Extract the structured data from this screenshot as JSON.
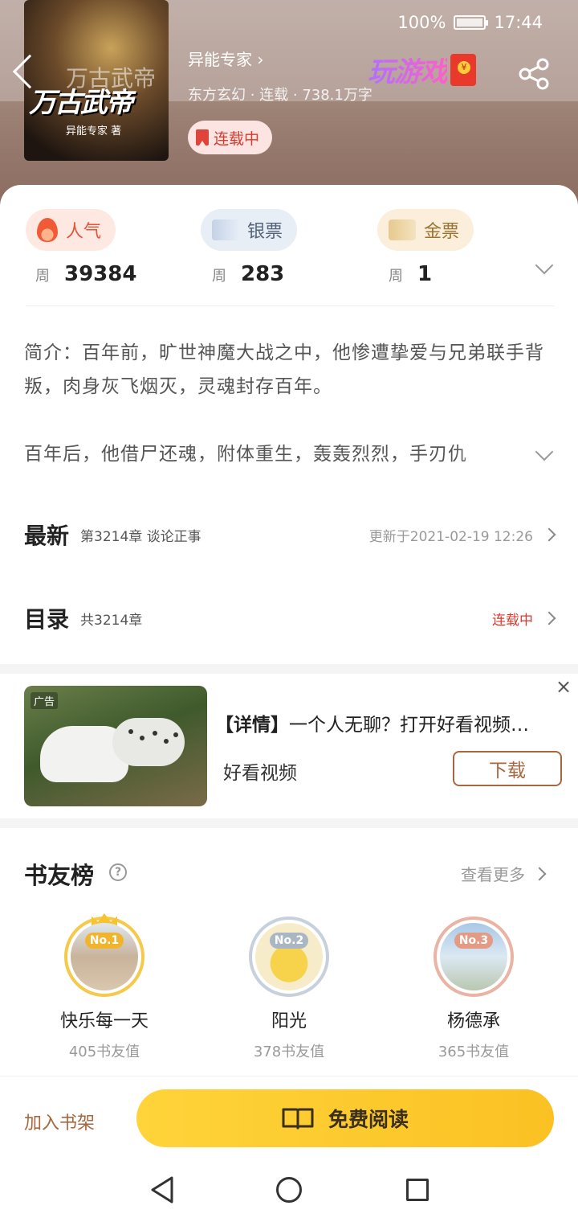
{
  "status": {
    "battery": "100%",
    "time": "17:44"
  },
  "book": {
    "cover_title": "万古武帝",
    "cover_author": "异能专家 著",
    "author": "异能专家",
    "meta": "东方玄幻 · 连载 · 738.1万字",
    "serial_badge": "连载中"
  },
  "header": {
    "game_label": "玩游戏"
  },
  "stats": {
    "popularity": {
      "label": "人气",
      "week": "周",
      "value": "39384"
    },
    "silver": {
      "label": "银票",
      "week": "周",
      "value": "283"
    },
    "gold": {
      "label": "金票",
      "week": "周",
      "value": "1"
    }
  },
  "intro": {
    "text1": "简介：百年前，旷世神魔大战之中，他惨遭挚爱与兄弟联手背叛，肉身灰飞烟灭，灵魂封存百年。",
    "text2": "百年后，他借尸还魂，附体重生，轰轰烈烈，手刃仇"
  },
  "latest": {
    "heading": "最新",
    "chapter": "第3214章  谈论正事",
    "updated": "更新于2021-02-19 12:26"
  },
  "toc": {
    "heading": "目录",
    "count": "共3214章",
    "status": "连载中"
  },
  "ad": {
    "tag": "广告",
    "title_bold": "【详情】",
    "title": "一个人无聊？打开好看视频…",
    "brand": "好看视频",
    "button": "下载",
    "close": "×"
  },
  "ranking": {
    "title": "书友榜",
    "more": "查看更多",
    "users": [
      {
        "rank": "No.1",
        "name": "快乐每一天",
        "score": "405书友值"
      },
      {
        "rank": "No.2",
        "name": "阳光",
        "score": "378书友值"
      },
      {
        "rank": "No.3",
        "name": "杨德承",
        "score": "365书友值"
      }
    ]
  },
  "bottom": {
    "shelf": "加入书架",
    "read": "免费阅读"
  },
  "colors": {
    "accent": "#fbc123",
    "brown": "#a8673e",
    "red": "#d93a2e"
  }
}
